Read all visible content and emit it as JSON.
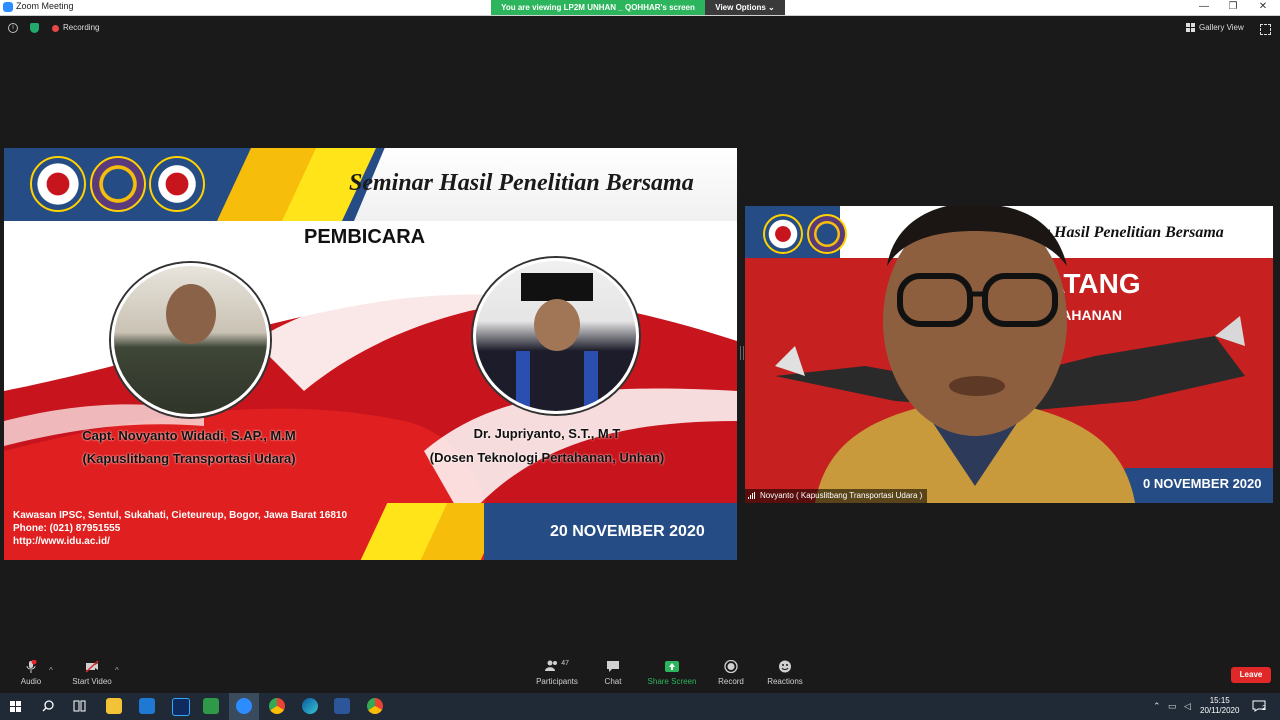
{
  "window": {
    "title": "Zoom Meeting",
    "minimize": "—",
    "restore": "❐",
    "close": "✕"
  },
  "share_banner": {
    "text": "You are viewing LP2M UNHAN _ QOHHAR's screen",
    "view_options": "View Options ⌄"
  },
  "meeting_bar": {
    "recording": "Recording",
    "gallery_view": "Gallery View"
  },
  "slide": {
    "title": "Seminar Hasil Penelitian Bersama",
    "heading": "PEMBICARA",
    "speakers": [
      {
        "name": "Capt. Novyanto Widadi, S.AP., M.M",
        "role": "(Kapuslitbang Transportasi Udara)"
      },
      {
        "name": "Dr. Jupriyanto, S.T., M.T",
        "role": "(Dosen Teknologi Pertahanan, Unhan)"
      }
    ],
    "address": "Kawasan IPSC, Sentul, Sukahati, Cieteureup, Bogor, Jawa Barat 16810",
    "phone": "Phone: (021) 87951555",
    "website": "http://www.idu.ac.id/",
    "date": "20 NOVEMBER 2020"
  },
  "video": {
    "background_title": "minar Hasil Penelitian Bersama",
    "background_heading": "DATANG",
    "background_sub": "PERTAHANAN",
    "background_date": "0 NOVEMBER 2020",
    "participant_name": "Novyanto ( Kapuslitbang Transportasi Udara )"
  },
  "controls": {
    "audio": "Audio",
    "start_video": "Start Video",
    "participants": "Participants",
    "participants_count": "47",
    "chat": "Chat",
    "share_screen": "Share Screen",
    "record": "Record",
    "reactions": "Reactions",
    "leave": "Leave",
    "caret": "^"
  },
  "taskbar": {
    "time": "15:15",
    "date": "20/11/2020",
    "notification_count": "2"
  },
  "colors": {
    "share_green": "#2db55d",
    "slide_blue": "#254c84",
    "slide_red": "#c62020",
    "slide_yellow": "#f6bd0a",
    "leave_red": "#e02828"
  }
}
